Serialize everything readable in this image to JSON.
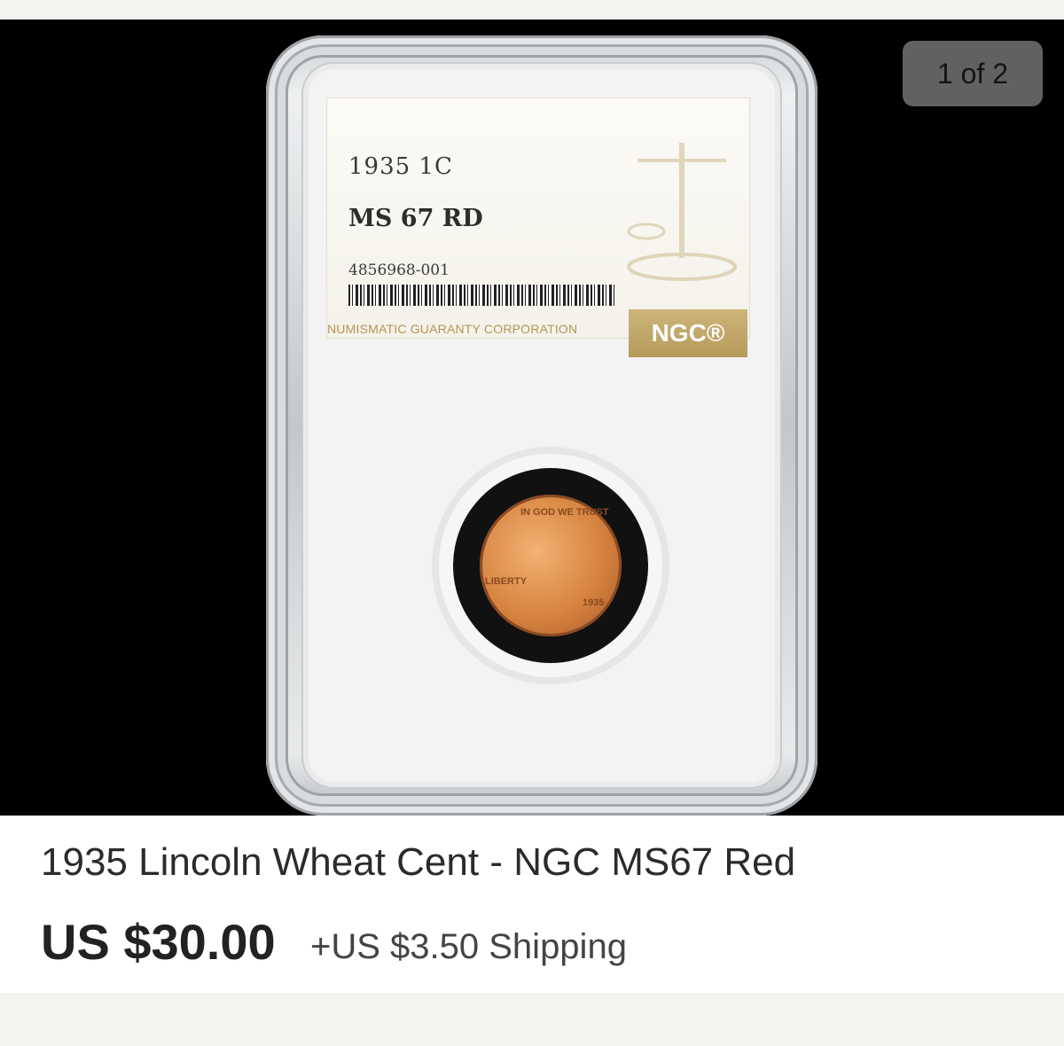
{
  "gallery": {
    "counter": "1 of 2"
  },
  "slab_label": {
    "year_denom": "1935  1C",
    "grade": "MS 67 RD",
    "cert_number": "4856968-001",
    "corporation": "NUMISMATIC GUARANTY CORPORATION",
    "logo": "NGC®"
  },
  "coin": {
    "motto": "IN GOD WE TRUST",
    "liberty": "LIBERTY",
    "date": "1935"
  },
  "listing": {
    "title": "1935 Lincoln Wheat Cent - NGC MS67 Red",
    "price": "US $30.00",
    "shipping": "+US $3.50 Shipping"
  },
  "colors": {
    "page_bg": "#f4f3ef",
    "photo_bg": "#000000",
    "counter_bg": "#616163",
    "ngc_gold": "#b59a5a"
  }
}
